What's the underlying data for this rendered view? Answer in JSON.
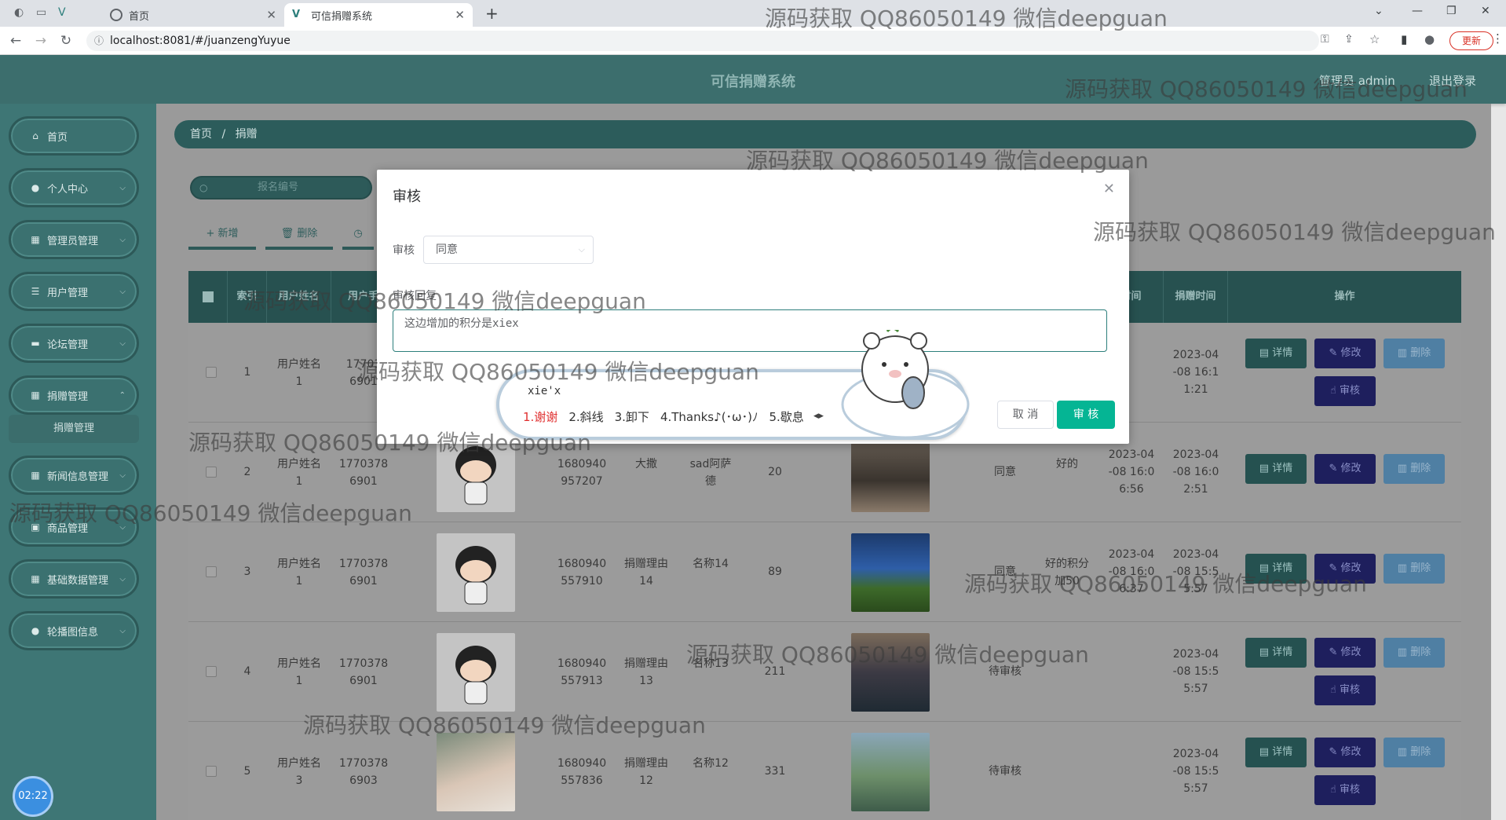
{
  "browser": {
    "tabs": [
      {
        "label": "首页",
        "active": false
      },
      {
        "label": "可信捐赠系统",
        "active": true
      }
    ],
    "url": "localhost:8081/#/juanzengYuyue",
    "update_label": "更新"
  },
  "header": {
    "title": "可信捐赠系统",
    "admin_label": "管理员 admin",
    "logout_label": "退出登录"
  },
  "sidebar": {
    "items": [
      {
        "label": "首页",
        "icon": "home-icon"
      },
      {
        "label": "个人中心",
        "icon": "person-icon"
      },
      {
        "label": "管理员管理",
        "icon": "grid-icon"
      },
      {
        "label": "用户管理",
        "icon": "list-icon"
      },
      {
        "label": "论坛管理",
        "icon": "chat-icon"
      },
      {
        "label": "捐赠管理",
        "icon": "grid-icon"
      },
      {
        "label": "新闻信息管理",
        "icon": "grid-icon"
      },
      {
        "label": "商品管理",
        "icon": "bag-icon"
      },
      {
        "label": "基础数据管理",
        "icon": "grid-icon"
      },
      {
        "label": "轮播图信息",
        "icon": "person-icon"
      }
    ],
    "submenu_label": "捐赠管理",
    "clock": "02:22"
  },
  "breadcrumb": {
    "home": "首页",
    "sep": "/",
    "current": "捐赠"
  },
  "toolbar": {
    "search_placeholder": "报名编号",
    "add_label": "+ 新增",
    "delete_label": "删除"
  },
  "table": {
    "headers": {
      "index": "索引",
      "username": "用户姓名",
      "phone": "用户手",
      "audit_time": "时间",
      "donate_time": "捐赠时间",
      "ops": "操作"
    },
    "rows": [
      {
        "index": "1",
        "username": "用户姓名\n1",
        "phone": "17703\n6901",
        "code": "",
        "reason": "",
        "name": "",
        "qty": "",
        "audit": "",
        "reply": "",
        "audit_time": "",
        "donate_time": "2023-04\n-08 16:1\n1:21",
        "has_audit": true
      },
      {
        "index": "2",
        "username": "用户姓名\n1",
        "phone": "1770378\n6901",
        "code": "1680940\n957207",
        "reason": "大撒",
        "name": "sad阿萨\n德",
        "qty": "20",
        "audit": "同意",
        "reply": "好的",
        "audit_time": "2023-04\n-08 16:0\n6:56",
        "donate_time": "2023-04\n-08 16:0\n2:51",
        "has_audit": false
      },
      {
        "index": "3",
        "username": "用户姓名\n1",
        "phone": "1770378\n6901",
        "code": "1680940\n557910",
        "reason": "捐赠理由\n14",
        "name": "名称14",
        "qty": "89",
        "audit": "同意",
        "reply": "好的积分\n加50",
        "audit_time": "2023-04\n-08 16:0\n6:37",
        "donate_time": "2023-04\n-08 15:5\n5:57",
        "has_audit": false
      },
      {
        "index": "4",
        "username": "用户姓名\n1",
        "phone": "1770378\n6901",
        "code": "1680940\n557913",
        "reason": "捐赠理由\n13",
        "name": "名称13",
        "qty": "211",
        "audit": "待审核",
        "reply": "",
        "audit_time": "",
        "donate_time": "2023-04\n-08 15:5\n5:57",
        "has_audit": true
      },
      {
        "index": "5",
        "username": "用户姓名\n3",
        "phone": "1770378\n6903",
        "code": "1680940\n557836",
        "reason": "捐赠理由\n12",
        "name": "名称12",
        "qty": "331",
        "audit": "待审核",
        "reply": "",
        "audit_time": "",
        "donate_time": "2023-04\n-08 15:5\n5:57",
        "has_audit": true
      }
    ],
    "btn_detail": "详情",
    "btn_edit": "修改",
    "btn_delete": "删除",
    "btn_audit": "审核"
  },
  "modal": {
    "title": "审核",
    "audit_label": "审核",
    "audit_value": "同意",
    "reply_label": "审核回复",
    "reply_value": "这边增加的积分是xiex",
    "cancel_label": "取 消",
    "confirm_label": "审 核"
  },
  "ime": {
    "input": "xie'x",
    "candidates": [
      "1.谢谢",
      "2.斜线",
      "3.卸下",
      "4.Thanks♪(･ω･)ﾉ",
      "5.歇息"
    ]
  },
  "watermark": "源码获取 QQ86050149 微信deepguan"
}
